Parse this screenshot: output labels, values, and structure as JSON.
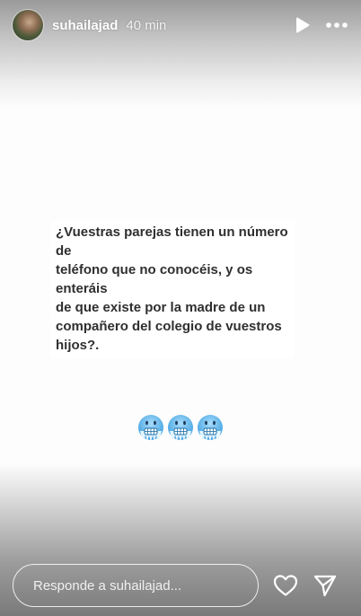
{
  "header": {
    "username": "suhailajad",
    "time_ago": "40 min"
  },
  "story": {
    "text": "¿Vuestras parejas tienen un número de\nteléfono que no conocéis, y os enteráis\nde que existe por la madre de un\ncompañero del colegio de vuestros\nhijos?.",
    "emojis": [
      "cold-face-emoji",
      "cold-face-emoji",
      "cold-face-emoji"
    ]
  },
  "footer": {
    "reply_placeholder": "Responde a suhailajad..."
  },
  "colors": {
    "text_dark": "#2f2f2f",
    "overlay_white": "#ffffff",
    "emoji_blue": "#5fb4ea"
  },
  "icons": {
    "play": "play-icon",
    "more": "more-options-icon",
    "like": "heart-icon",
    "share": "send-icon"
  }
}
